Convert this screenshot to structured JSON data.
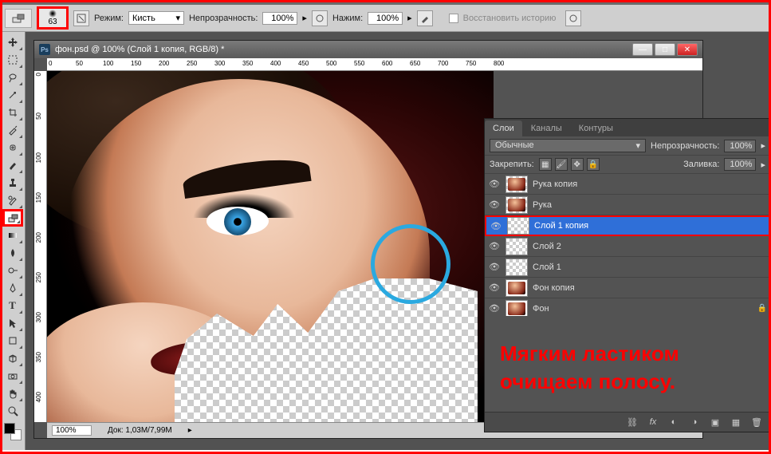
{
  "options": {
    "brush_size": "63",
    "mode_label": "Режим:",
    "mode_value": "Кисть",
    "opacity_label": "Непрозрачность:",
    "opacity_value": "100%",
    "flow_label": "Нажим:",
    "flow_value": "100%",
    "restore_label": "Восстановить историю"
  },
  "document": {
    "title": "фон.psd @ 100% (Слой 1 копия, RGB/8) *",
    "zoom": "100%",
    "doc_size": "Док: 1,03M/7,99M"
  },
  "ruler": {
    "h": [
      "0",
      "50",
      "100",
      "150",
      "200",
      "250",
      "300",
      "350",
      "400",
      "450",
      "500",
      "550",
      "600",
      "650",
      "700",
      "750",
      "800"
    ],
    "v": [
      "0",
      "50",
      "100",
      "150",
      "200",
      "250",
      "300",
      "350",
      "400"
    ]
  },
  "panel": {
    "tabs": [
      "Слои",
      "Каналы",
      "Контуры"
    ],
    "blend_mode": "Обычные",
    "opacity_label": "Непрозрачность:",
    "opacity_value": "100%",
    "lock_label": "Закрепить:",
    "fill_label": "Заливка:",
    "fill_value": "100%",
    "layers": [
      {
        "name": "Рука копия",
        "thumb": "tp-mini",
        "locked": false,
        "selected": false
      },
      {
        "name": "Рука",
        "thumb": "tp-mini",
        "locked": false,
        "selected": false
      },
      {
        "name": "Слой 1 копия",
        "thumb": "tp",
        "locked": false,
        "selected": true
      },
      {
        "name": "Слой 2",
        "thumb": "tp",
        "locked": false,
        "selected": false
      },
      {
        "name": "Слой 1",
        "thumb": "tp",
        "locked": false,
        "selected": false
      },
      {
        "name": "Фон копия",
        "thumb": "mini",
        "locked": false,
        "selected": false
      },
      {
        "name": "Фон",
        "thumb": "mini",
        "locked": true,
        "selected": false
      }
    ]
  },
  "annotation": {
    "line1": "Мягким ластиком",
    "line2": "очищаем полосу."
  },
  "tools": {
    "selected": "eraser"
  }
}
